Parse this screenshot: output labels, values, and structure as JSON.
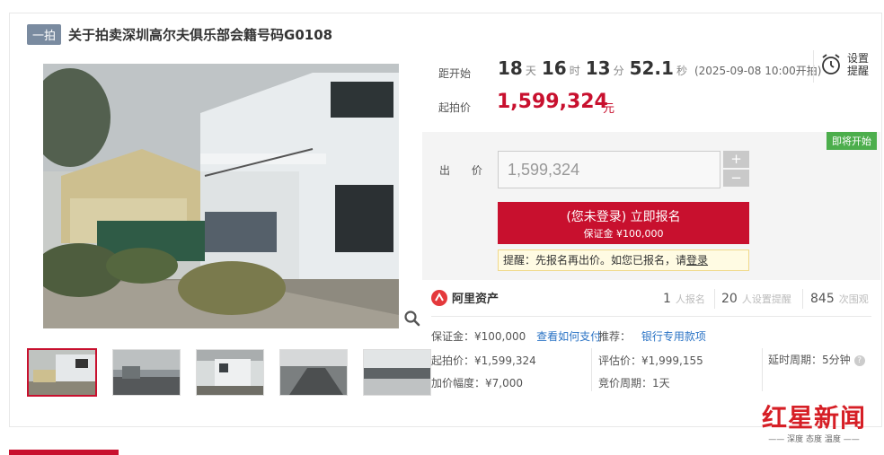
{
  "header": {
    "tag": "一拍",
    "title": "关于拍卖深圳高尔夫俱乐部会籍号码G0108"
  },
  "countdown": {
    "label": "距开始",
    "days": "18",
    "days_unit": "天",
    "hours": "16",
    "hours_unit": "时",
    "minutes": "13",
    "minutes_unit": "分",
    "seconds": "52.1",
    "seconds_unit": "秒",
    "open_time": "(2025-09-08 10:00开拍)"
  },
  "reminder": {
    "line1": "设置",
    "line2": "提醒",
    "icon": "alarm-clock-icon"
  },
  "start_price": {
    "label": "起拍价",
    "value": "1,599,324",
    "unit": "元"
  },
  "bid": {
    "status_badge": "即将开始",
    "label": "出 价",
    "input_value": "1,599,324",
    "plus": "+",
    "minus": "−",
    "signup_main": "(您未登录) 立即报名",
    "signup_sub": "保证金 ¥100,000",
    "tip_prefix": "提醒：先报名再出价。如您已报名，请",
    "tip_link": "登录"
  },
  "platform": {
    "name": "阿里资产"
  },
  "stats": [
    {
      "value": "1",
      "label": "人报名"
    },
    {
      "value": "20",
      "label": "人设置提醒"
    },
    {
      "value": "845",
      "label": "次围观"
    }
  ],
  "info": {
    "deposit_label": "保证金：",
    "deposit_value": "¥100,000",
    "how_to_pay": "查看如何支付",
    "recommend_label": "推荐：",
    "recommend_link": "银行专用款项",
    "start_price_label": "起拍价：",
    "start_price_value": "¥1,599,324",
    "increment_label": "加价幅度：",
    "increment_value": "¥7,000",
    "appraisal_label": "评估价：",
    "appraisal_value": "¥1,999,155",
    "cycle_label": "竞价周期：",
    "cycle_value": "1天",
    "delay_label": "延时周期：",
    "delay_value": "5分钟"
  },
  "watermark": {
    "title": "红星新闻",
    "subtitle": "—— 深度 态度 温度 ——"
  },
  "colors": {
    "accent": "#c8102e",
    "badge_green": "#4cae4c",
    "link": "#2a73c5"
  }
}
